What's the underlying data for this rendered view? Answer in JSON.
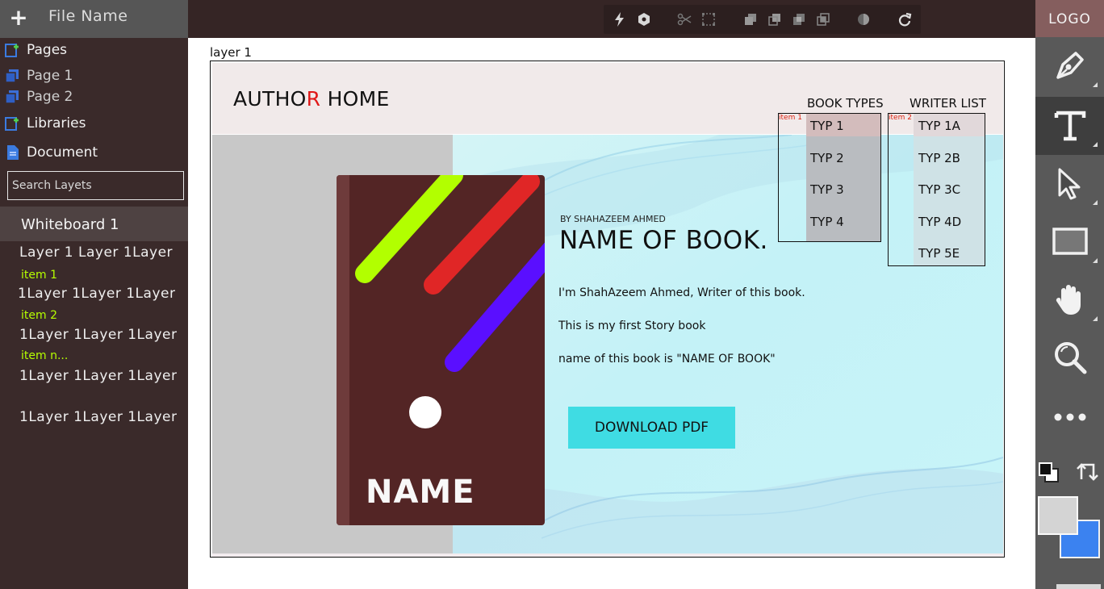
{
  "sidebar": {
    "file_name": "File Name",
    "nav": [
      {
        "label": "Pages",
        "icon": "add-page-icon"
      },
      {
        "label": "Page 1",
        "icon": "page-stack-icon"
      },
      {
        "label": "Page 2",
        "icon": "page-stack-icon"
      },
      {
        "label": "Libraries",
        "icon": "add-library-icon"
      },
      {
        "label": "Document",
        "icon": "document-icon"
      }
    ],
    "search_placeholder": "Search Layets",
    "whiteboard": "Whiteboard 1",
    "tree": {
      "row1": "Layer 1 Layer 1Layer",
      "item1": "item 1",
      "row2": "1Layer 1Layer 1Layer",
      "item2": "item 2",
      "row3": "1Layer 1Layer 1Layer",
      "itemn": "item n...",
      "row4": "1Layer 1Layer 1Layer",
      "row5": "1Layer 1Layer 1Layer"
    }
  },
  "toolbar": {
    "icons": [
      "lightning-icon",
      "hexagon-icon",
      "scissors-icon",
      "crop-icon",
      "bring-front-icon",
      "send-back-icon",
      "union-icon",
      "intersect-icon",
      "mask-icon",
      "redo-icon"
    ]
  },
  "right_panel": {
    "logo": "LOGO",
    "tools": [
      "pen-tool-icon",
      "text-tool-icon",
      "select-tool-icon",
      "rectangle-tool-icon",
      "hand-tool-icon",
      "zoom-tool-icon",
      "more-icon"
    ],
    "active_tool": "text-tool-icon",
    "fill_color": "#d4d4d4",
    "stroke_color": "#3b82f0"
  },
  "canvas": {
    "layer_label": "layer 1",
    "site": {
      "brand_prefix": "AUTHO",
      "brand_accent": "R",
      "brand_suffix": " HOME",
      "brand_accent_color": "#e01818",
      "nav_book_types": "BOOK TYPES",
      "nav_writer_list": "WRITER LIST",
      "book_cover_name": "NAME",
      "by_author": "BY SHAHAZEEM AHMED",
      "book_title": "NAME OF BOOK.",
      "desc1": "I'm ShahAzeem Ahmed, Writer of this book.",
      "desc2": "This is my first Story book",
      "desc3": "name of this book is \"NAME OF BOOK\"",
      "download": "DOWNLOAD PDF",
      "dropdown1": {
        "tag": "item 1",
        "options": [
          "TYP 1",
          "TYP 2",
          "TYP 3",
          "TYP 4"
        ]
      },
      "dropdown2": {
        "tag": "item 2",
        "options": [
          "TYP 1A",
          "TYP 2B",
          "TYP 3C",
          "TYP 4D",
          "TYP 5E"
        ]
      }
    }
  }
}
